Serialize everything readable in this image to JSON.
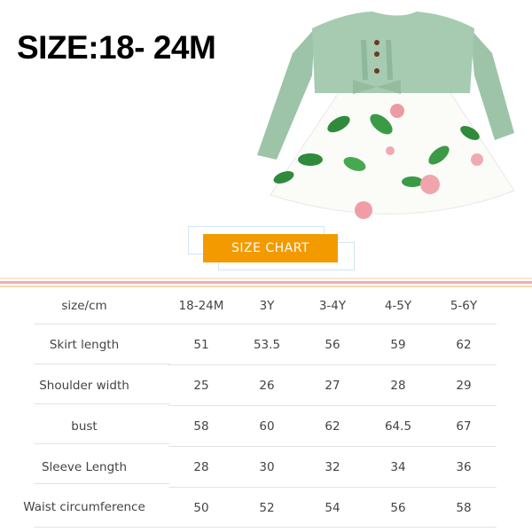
{
  "title": "SIZE:18- 24M",
  "badge_label": "SIZE CHART",
  "colors": {
    "badge": "#f39a00",
    "stripe_pink": "#eeadb9",
    "stripe_peach": "#fbd7a8",
    "bodice": "#9dc4a8"
  },
  "image": {
    "alt": "green ribbed long-sleeve ruffle dress with white rose-print skirt"
  },
  "table": {
    "header": [
      "size/cm",
      "18-24M",
      "3Y",
      "3-4Y",
      "4-5Y",
      "5-6Y"
    ],
    "rows": [
      {
        "label": "Skirt length",
        "values": [
          "51",
          "53.5",
          "56",
          "59",
          "62"
        ]
      },
      {
        "label": "Shoulder width",
        "values": [
          "25",
          "26",
          "27",
          "28",
          "29"
        ]
      },
      {
        "label": "bust",
        "values": [
          "58",
          "60",
          "62",
          "64.5",
          "67"
        ]
      },
      {
        "label": "Sleeve Length",
        "values": [
          "28",
          "30",
          "32",
          "34",
          "36"
        ]
      },
      {
        "label": "Waist circumference",
        "values": [
          "50",
          "52",
          "54",
          "56",
          "58"
        ]
      }
    ]
  }
}
